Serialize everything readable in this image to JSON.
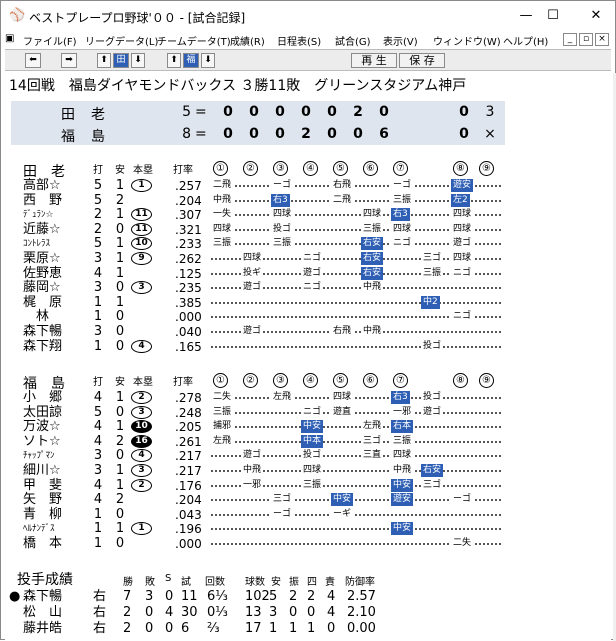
{
  "window": {
    "title": "ベストプレープロ野球'００ - [試合記録]",
    "controls": [
      "—",
      "☐",
      "✕"
    ]
  },
  "menu": [
    "ファイル(F)",
    "リーグデータ(L)",
    "チームデータ(T)",
    "成績(R)",
    "日程表(S)",
    "試合(G)",
    "表示(V)",
    "ウィンドウ(W)",
    "ヘルプ(H)"
  ],
  "menu_buttons": [
    "_",
    "▫",
    "×"
  ],
  "toolbar": {
    "left": "⬅",
    "right": "➡",
    "up1": "⬆",
    "tab1": "田",
    "down1": "⬇",
    "up2": "⬆",
    "tab2": "福",
    "down2": "⬇",
    "play": "再 生",
    "save": "保 存"
  },
  "game_title": "14回戦　福島ダイヤモンドバックス ３勝11敗　グリーンスタジアム神戸",
  "scoreboard": [
    {
      "team": "田老",
      "runs": "5",
      "eq": "=",
      "innings": [
        "0",
        "0",
        "0",
        "0",
        "0",
        "2",
        "0",
        "",
        "0"
      ],
      "extra": "3"
    },
    {
      "team": "福島",
      "runs": "8",
      "eq": "=",
      "innings": [
        "0",
        "0",
        "0",
        "2",
        "0",
        "0",
        "6",
        "",
        "0"
      ],
      "extra": "×"
    }
  ],
  "batting_headers": {
    "da": "打",
    "an": "安",
    "hr": "本塁",
    "avg": "打率"
  },
  "inning_labels": [
    "①",
    "②",
    "③",
    "④",
    "⑤",
    "⑥",
    "⑦",
    "⑧",
    "⑨"
  ],
  "team1": {
    "name": "田老",
    "players": [
      {
        "name": "高部☆",
        "small": false,
        "ab": "5",
        "h": "1",
        "hr": "1",
        "hr_inv": false,
        "avg": ".257",
        "res": [
          [
            "二飛",
            0,
            false
          ],
          [
            "ーゴ",
            2,
            false
          ],
          [
            "右飛",
            4,
            false
          ],
          [
            "ーゴ",
            6,
            false
          ],
          [
            "遊安",
            8,
            true
          ]
        ]
      },
      {
        "name": "西　野",
        "small": false,
        "ab": "5",
        "h": "2",
        "hr": "",
        "hr_inv": false,
        "avg": ".204",
        "res": [
          [
            "中飛",
            0,
            false
          ],
          [
            "右3",
            2,
            true
          ],
          [
            "二飛",
            4,
            false
          ],
          [
            "三振",
            6,
            false
          ],
          [
            "左2",
            8,
            true
          ]
        ]
      },
      {
        "name": "ﾃﾞｭﾗﾝ☆",
        "small": true,
        "ab": "2",
        "h": "1",
        "hr": "11",
        "hr_inv": false,
        "avg": ".307",
        "res": [
          [
            "一失",
            0,
            false
          ],
          [
            "四球",
            2,
            false
          ],
          [
            "四球",
            5,
            false
          ],
          [
            "右3",
            6,
            true
          ],
          [
            "四球",
            8,
            false
          ]
        ]
      },
      {
        "name": "近藤☆",
        "small": false,
        "ab": "2",
        "h": "0",
        "hr": "11",
        "hr_inv": false,
        "avg": ".321",
        "res": [
          [
            "四球",
            0,
            false
          ],
          [
            "投ゴ",
            2,
            false
          ],
          [
            "三振",
            5,
            false
          ],
          [
            "四球",
            6,
            false
          ],
          [
            "四球",
            8,
            false
          ]
        ]
      },
      {
        "name": "ｺﾝﾄﾚﾗｽ",
        "small": true,
        "ab": "5",
        "h": "1",
        "hr": "10",
        "hr_inv": false,
        "avg": ".233",
        "res": [
          [
            "三振",
            0,
            false
          ],
          [
            "三振",
            2,
            false
          ],
          [
            "右安",
            5,
            true
          ],
          [
            "ニゴ",
            6,
            false
          ],
          [
            "遊ゴ",
            8,
            false
          ]
        ]
      },
      {
        "name": "栗原☆",
        "small": false,
        "ab": "3",
        "h": "1",
        "hr": "9",
        "hr_inv": false,
        "avg": ".262",
        "res": [
          [
            "四球",
            1,
            false
          ],
          [
            "ニゴ",
            3,
            false
          ],
          [
            "右安",
            5,
            true
          ],
          [
            "三ゴ",
            7,
            false
          ],
          [
            "四球",
            8,
            false
          ]
        ]
      },
      {
        "name": "佐野恵",
        "small": false,
        "ab": "4",
        "h": "1",
        "hr": "",
        "hr_inv": false,
        "avg": ".125",
        "res": [
          [
            "投ギ",
            1,
            false
          ],
          [
            "遊ゴ",
            3,
            false
          ],
          [
            "右安",
            5,
            true
          ],
          [
            "三振",
            7,
            false
          ],
          [
            "ニゴ",
            8,
            false
          ]
        ]
      },
      {
        "name": "藤岡☆",
        "small": false,
        "ab": "3",
        "h": "0",
        "hr": "3",
        "hr_inv": false,
        "avg": ".235",
        "res": [
          [
            "遊ゴ",
            1,
            false
          ],
          [
            "ニゴ",
            3,
            false
          ],
          [
            "中飛",
            5,
            false
          ]
        ]
      },
      {
        "name": "梶　原",
        "small": false,
        "ab": "1",
        "h": "1",
        "hr": "",
        "hr_inv": false,
        "avg": ".385",
        "res": [
          [
            "中2",
            7,
            true
          ]
        ]
      },
      {
        "name": "　林",
        "small": false,
        "ab": "1",
        "h": "0",
        "hr": "",
        "hr_inv": false,
        "avg": ".000",
        "res": [
          [
            "ニゴ",
            8,
            false
          ]
        ]
      },
      {
        "name": "森下暢",
        "small": false,
        "ab": "3",
        "h": "0",
        "hr": "",
        "hr_inv": false,
        "avg": ".040",
        "res": [
          [
            "遊ゴ",
            1,
            false
          ],
          [
            "右飛",
            4,
            false
          ],
          [
            "中飛",
            5,
            false
          ]
        ]
      },
      {
        "name": "森下翔",
        "small": false,
        "ab": "1",
        "h": "0",
        "hr": "4",
        "hr_inv": false,
        "avg": ".165",
        "res": [
          [
            "投ゴ",
            7,
            false
          ]
        ]
      }
    ]
  },
  "team2": {
    "name": "福島",
    "players": [
      {
        "name": "小　郷",
        "small": false,
        "ab": "4",
        "h": "1",
        "hr": "2",
        "hr_inv": false,
        "avg": ".278",
        "res": [
          [
            "二失",
            0,
            false
          ],
          [
            "左飛",
            2,
            false
          ],
          [
            "四球",
            4,
            false
          ],
          [
            "右3",
            6,
            true
          ],
          [
            "投ゴ",
            7,
            false
          ]
        ]
      },
      {
        "name": "太田諒",
        "small": false,
        "ab": "5",
        "h": "0",
        "hr": "3",
        "hr_inv": false,
        "avg": ".248",
        "res": [
          [
            "三振",
            0,
            false
          ],
          [
            "ニゴ",
            3,
            false
          ],
          [
            "遊直",
            4,
            false
          ],
          [
            "一邪",
            6,
            false
          ],
          [
            "遊ゴ",
            7,
            false
          ]
        ]
      },
      {
        "name": "万波☆",
        "small": false,
        "ab": "4",
        "h": "1",
        "hr": "10",
        "hr_inv": true,
        "avg": ".205",
        "res": [
          [
            "捕邪",
            0,
            false
          ],
          [
            "中安",
            3,
            true
          ],
          [
            "左飛",
            5,
            false
          ],
          [
            "右本",
            6,
            true
          ]
        ]
      },
      {
        "name": "ソト☆",
        "small": false,
        "ab": "4",
        "h": "2",
        "hr": "16",
        "hr_inv": true,
        "avg": ".261",
        "res": [
          [
            "左飛",
            0,
            false
          ],
          [
            "中本",
            3,
            true
          ],
          [
            "三ゴ",
            5,
            false
          ],
          [
            "三振",
            6,
            false
          ]
        ]
      },
      {
        "name": "ﾁｬｯﾌﾟﾏﾝ",
        "small": true,
        "ab": "3",
        "h": "0",
        "hr": "4",
        "hr_inv": false,
        "avg": ".217",
        "res": [
          [
            "遊ゴ",
            1,
            false
          ],
          [
            "投ゴ",
            3,
            false
          ],
          [
            "三直",
            5,
            false
          ],
          [
            "四球",
            6,
            false
          ]
        ]
      },
      {
        "name": "細川☆",
        "small": false,
        "ab": "3",
        "h": "1",
        "hr": "3",
        "hr_inv": false,
        "avg": ".217",
        "res": [
          [
            "中飛",
            1,
            false
          ],
          [
            "四球",
            3,
            false
          ],
          [
            "中飛",
            6,
            false
          ],
          [
            "右安",
            7,
            true
          ]
        ]
      },
      {
        "name": "甲　斐",
        "small": false,
        "ab": "4",
        "h": "1",
        "hr": "2",
        "hr_inv": false,
        "avg": ".176",
        "res": [
          [
            "一邪",
            1,
            false
          ],
          [
            "三振",
            3,
            false
          ],
          [
            "中安",
            6,
            true
          ],
          [
            "三ゴ",
            7,
            false
          ]
        ]
      },
      {
        "name": "矢　野",
        "small": false,
        "ab": "4",
        "h": "2",
        "hr": "",
        "hr_inv": false,
        "avg": ".204",
        "res": [
          [
            "三ゴ",
            2,
            false
          ],
          [
            "中安",
            4,
            true
          ],
          [
            "遊安",
            6,
            true
          ],
          [
            "ーゴ",
            8,
            false
          ]
        ]
      },
      {
        "name": "青　柳",
        "small": false,
        "ab": "1",
        "h": "0",
        "hr": "",
        "hr_inv": false,
        "avg": ".043",
        "res": [
          [
            "ーゴ",
            2,
            false
          ],
          [
            "ーギ",
            4,
            false
          ]
        ]
      },
      {
        "name": "ﾍﾙﾅﾝﾃﾞｽ",
        "small": true,
        "ab": "1",
        "h": "1",
        "hr": "1",
        "hr_inv": false,
        "avg": ".196",
        "res": [
          [
            "中安",
            6,
            true
          ]
        ]
      },
      {
        "name": "橋　本",
        "small": false,
        "ab": "1",
        "h": "0",
        "hr": "",
        "hr_inv": false,
        "avg": ".000",
        "res": [
          [
            "二失",
            8,
            false
          ]
        ]
      }
    ]
  },
  "pitching": {
    "title": "投手成績",
    "headers": [
      "勝",
      "敗",
      "S",
      "試",
      "回数",
      "球数",
      "安",
      "振",
      "四",
      "責",
      "防御率"
    ],
    "rows": [
      {
        "mark": "●",
        "name": "森下暢",
        "hand": "右",
        "w": "7",
        "l": "3",
        "s": "0",
        "g": "11",
        "ip": "6⅓",
        "np": "102",
        "h": "5",
        "k": "2",
        "bb": "2",
        "er": "4",
        "era": "2.57"
      },
      {
        "mark": "",
        "name": "松　山",
        "hand": "右",
        "w": "2",
        "l": "0",
        "s": "4",
        "g": "30",
        "ip": "0⅓",
        "np": "13",
        "h": "3",
        "k": "0",
        "bb": "0",
        "er": "4",
        "era": "2.10"
      },
      {
        "mark": "",
        "name": "藤井皓",
        "hand": "右",
        "w": "2",
        "l": "0",
        "s": "0",
        "g": "6",
        "ip": "⅔",
        "np": "17",
        "h": "1",
        "k": "1",
        "bb": "1",
        "er": "0",
        "era": "0.00"
      }
    ]
  }
}
